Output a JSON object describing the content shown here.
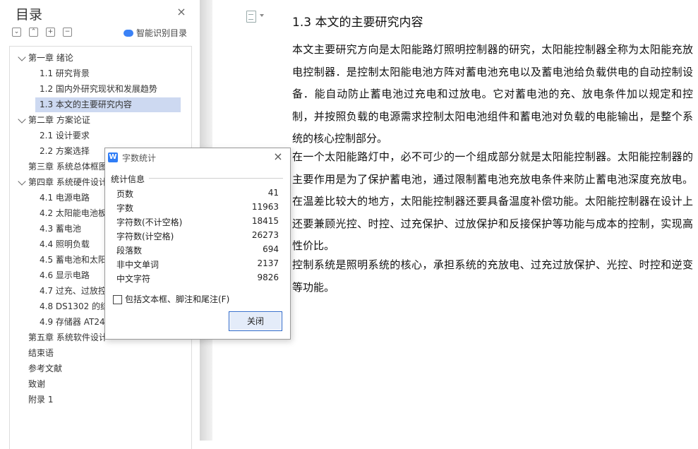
{
  "toc": {
    "title": "目录",
    "smart_label": "智能识别目录",
    "toolbar": [
      "collapse-all",
      "expand-up",
      "add",
      "remove"
    ],
    "items": [
      {
        "label": "第一章  绪论",
        "level": 1,
        "expanded": true
      },
      {
        "label": "1.1 研究背景",
        "level": 2
      },
      {
        "label": "1.2 国内外研究现状和发展趋势",
        "level": 2
      },
      {
        "label": "1.3 本文的主要研究内容",
        "level": 2,
        "selected": true
      },
      {
        "label": "第二章  方案论证",
        "level": 1,
        "expanded": true
      },
      {
        "label": "2.1  设计要求",
        "level": 2
      },
      {
        "label": "2.2  方案选择",
        "level": 2
      },
      {
        "label": "第三章  系统总体框图",
        "level": 1
      },
      {
        "label": "第四章  系统硬件设计",
        "level": 1,
        "expanded": true
      },
      {
        "label": "4.1  电源电路",
        "level": 2
      },
      {
        "label": "4.2  太阳能电池板",
        "level": 2
      },
      {
        "label": "4.3  蓄电池",
        "level": 2
      },
      {
        "label": "4.4  照明负载",
        "level": 2
      },
      {
        "label": "4.5  蓄电池和太阳",
        "level": 2
      },
      {
        "label": "4.6  显示电路",
        "level": 2
      },
      {
        "label": "4.7  过充、过放控",
        "level": 2
      },
      {
        "label": "4.8 DS1302 的结",
        "level": 2
      },
      {
        "label": "4.9  存储器 AT24C",
        "level": 2
      },
      {
        "label": "第五章  系统软件设计",
        "level": 1
      },
      {
        "label": "结束语",
        "level": 1
      },
      {
        "label": "参考文献",
        "level": 1
      },
      {
        "label": "致谢",
        "level": 1
      },
      {
        "label": "附录 1",
        "level": 1
      }
    ]
  },
  "document": {
    "heading": "1.3 本文的主要研究内容",
    "paragraphs": [
      "本文主要研究方向是太阳能路灯照明控制器的研究，太阳能控制器全称为太阳能充放电控制器．是控制太阳能电池方阵对蓄电池充电以及蓄电池给负载供电的自动控制设备．能自动防止蓄电池过充电和过放电。它对蓄电池的充、放电条件加以规定和控制，并按照负载的电源需求控制太阳电池组件和蓄电池对负载的电能输出，是整个系统的核心控制部分。",
      "在一个太阳能路灯中，必不可少的一个组成部分就是太阳能控制器。太阳能控制器的主要作用是为了保护蓄电池，通过限制蓄电池充放电条件来防止蓄电池深度充放电。在温差比较大的地方，太阳能控制器还要具备温度补偿功能。太阳能控制器在设计上还要兼顾光控、时控、过充保护、过放保护和反接保护等功能与成本的控制，实现高性价比。",
      "控制系统是照明系统的核心，承担系统的充放电、过充过放保护、光控、时控和逆变等功能。"
    ]
  },
  "dialog": {
    "title": "字数统计",
    "icon_letter": "W",
    "section_label": "统计信息",
    "stats": [
      {
        "label": "页数",
        "value": "41"
      },
      {
        "label": "字数",
        "value": "11963"
      },
      {
        "label": "字符数(不计空格)",
        "value": "18415"
      },
      {
        "label": "字符数(计空格)",
        "value": "26273"
      },
      {
        "label": "段落数",
        "value": "694"
      },
      {
        "label": "非中文单词",
        "value": "2137"
      },
      {
        "label": "中文字符",
        "value": "9826"
      }
    ],
    "checkbox_label": "包括文本框、脚注和尾注(F)",
    "checkbox_checked": false,
    "close_button": "关闭"
  },
  "colors": {
    "selected_bg": "#cdd9f1",
    "accent": "#2f7df6"
  }
}
